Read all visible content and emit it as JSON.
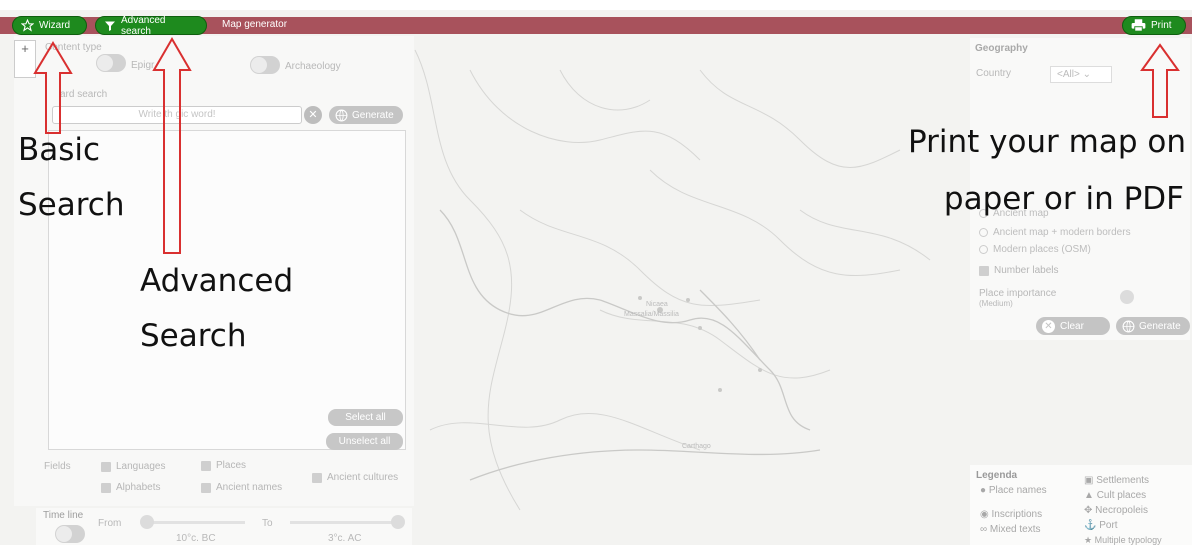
{
  "topbar": {
    "wizard_label": "Wizard",
    "advanced_search_label": "Advanced search",
    "map_generator_label": "Map generator",
    "print_label": "Print"
  },
  "left_panel": {
    "zoom_label": "+",
    "content_type_label": "Content type",
    "epigraphy_label": "Epigr",
    "archaeology_label": "Archaeology",
    "keyword_search_label": "ard search",
    "magic_word_placeholder": "Write th     gic word!",
    "clear_label": "✕",
    "generate_label": "Generate",
    "select_all_label": "Select all",
    "unselect_all_label": "Unselect all",
    "fields_label": "Fields",
    "fields": {
      "languages": "Languages",
      "places": "Places",
      "ancient_cultures": "Ancient cultures",
      "alphabets": "Alphabets",
      "ancient_names": "Ancient names"
    }
  },
  "timeline": {
    "label": "Time line",
    "from_label": "From",
    "to_label": "To",
    "from_value": "10°c. BC",
    "to_value": "3°c. AC"
  },
  "right_panel": {
    "geography_label": "Geography",
    "country_label": "Country",
    "country_value": "<All>",
    "map_types": [
      "Ancient map",
      "Ancient map + modern borders",
      "Modern places (OSM)"
    ],
    "number_labels": "Number labels",
    "place_importance_label": "Place importance",
    "place_importance_value": "(Medium)",
    "clear_label": "Clear",
    "generate_label": "Generate"
  },
  "legend": {
    "title": "Legenda",
    "place_names": "Place names",
    "inscriptions": "Inscriptions",
    "mixed_texts": "Mixed texts",
    "settlements": "Settlements",
    "cult_places": "Cult places",
    "necropoleis": "Necropoleis",
    "port": "Port",
    "multiple_typology": "Multiple typology"
  },
  "map_labels": {
    "city1": "Nicaea",
    "city2": "Massalia/Massilia",
    "city3": "Carthago"
  },
  "annotations": {
    "basic_line1": "Basic",
    "basic_line2": "Search",
    "advanced_line1": "Advanced",
    "advanced_line2": "Search",
    "print_line1": "Print your map on",
    "print_line2": "paper or in PDF"
  },
  "colors": {
    "topbar": "#a8525c",
    "pill_green": "#1e8a1e",
    "arrow_red": "#d93030"
  }
}
